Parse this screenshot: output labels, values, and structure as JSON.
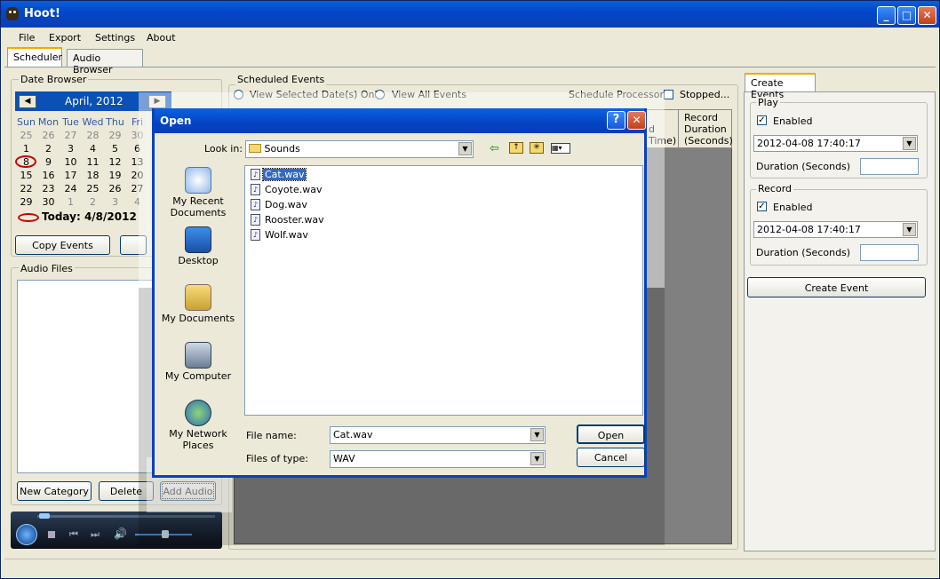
{
  "window": {
    "title": "Hoot!"
  },
  "menu": [
    "File",
    "Export",
    "Settings",
    "About"
  ],
  "tabs": [
    "Scheduler",
    "Audio Browser"
  ],
  "date_browser": {
    "label": "Date Browser",
    "month": "April, 2012",
    "weekdays": [
      "Sun",
      "Mon",
      "Tue",
      "Wed",
      "Thu",
      "Fri"
    ],
    "weeks": [
      [
        "25",
        "26",
        "27",
        "28",
        "29",
        "30"
      ],
      [
        "1",
        "2",
        "3",
        "4",
        "5",
        "6"
      ],
      [
        "8",
        "9",
        "10",
        "11",
        "12",
        "13"
      ],
      [
        "15",
        "16",
        "17",
        "18",
        "19",
        "20"
      ],
      [
        "22",
        "23",
        "24",
        "25",
        "26",
        "27"
      ],
      [
        "29",
        "30",
        "1",
        "2",
        "3",
        "4"
      ]
    ],
    "today": "Today: 4/8/2012",
    "copy_button": "Copy Events"
  },
  "audio_files": {
    "label": "Audio Files",
    "buttons": [
      "New Category",
      "Delete",
      "Add Audio"
    ]
  },
  "scheduled": {
    "label": "Scheduled Events",
    "radio_selected": "View Selected Date(s) Only",
    "radio_all": "View All Events",
    "processor_label": "Schedule Processor",
    "processor_status": "Stopped...",
    "col_record_duration": "Record Duration (Seconds)",
    "col_partial_d": "d",
    "col_partial_time": "Time)"
  },
  "create_events": {
    "tab": "Create Events",
    "play": {
      "label": "Play",
      "enabled": "Enabled",
      "datetime": "2012-04-08 17:40:17",
      "duration_label": "Duration (Seconds)"
    },
    "record": {
      "label": "Record",
      "enabled": "Enabled",
      "datetime": "2012-04-08 17:40:17",
      "duration_label": "Duration (Seconds)"
    },
    "button": "Create Event"
  },
  "dialog": {
    "title": "Open",
    "look_in_label": "Look in:",
    "look_in_value": "Sounds",
    "places": [
      "My Recent Documents",
      "Desktop",
      "My Documents",
      "My Computer",
      "My Network Places"
    ],
    "files": [
      "Cat.wav",
      "Coyote.wav",
      "Dog.wav",
      "Rooster.wav",
      "Wolf.wav"
    ],
    "selected_file": "Cat.wav",
    "file_name_label": "File name:",
    "file_name_value": "Cat.wav",
    "file_type_label": "Files of type:",
    "file_type_value": "WAV",
    "open_button": "Open",
    "cancel_button": "Cancel"
  },
  "colors": {
    "xp_blue": "#0a50b6",
    "selection": "#316ac5",
    "window_bg": "#ece9d8"
  }
}
